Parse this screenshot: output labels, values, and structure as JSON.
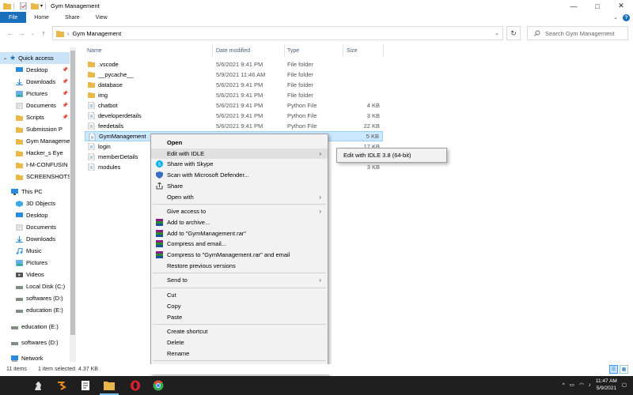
{
  "window": {
    "title": "Gym Management",
    "controls": {
      "minimize": "—",
      "maximize": "□",
      "close": "✕"
    }
  },
  "ribbon": {
    "tabs": [
      "File",
      "Home",
      "Share",
      "View"
    ],
    "help": "?"
  },
  "address": {
    "path_separator": "›",
    "path": "Gym Management",
    "search_placeholder": "Search Gym Management"
  },
  "nav": {
    "quick_access": "Quick access",
    "quick_items": [
      "Desktop",
      "Downloads",
      "Pictures",
      "Documents",
      "Scripts",
      "Submission P",
      "Gym Manageme",
      "Hacker_s Eye",
      "I-M-CONFUSIN",
      "SCREENSHOTS"
    ],
    "this_pc": "This PC",
    "pc_items": [
      "3D Objects",
      "Desktop",
      "Documents",
      "Downloads",
      "Music",
      "Pictures",
      "Videos",
      "Local Disk (C:)",
      "softwares (D:)",
      "education (E:)"
    ],
    "drives": [
      "education (E:)",
      "softwares (D:)"
    ],
    "network": "Network"
  },
  "columns": {
    "name": "Name",
    "date": "Date modified",
    "type": "Type",
    "size": "Size"
  },
  "files": [
    {
      "name": ".vscode",
      "date": "5/6/2021 9:41 PM",
      "type": "File folder",
      "size": "",
      "kind": "folder"
    },
    {
      "name": "__pycache__",
      "date": "5/9/2021 11:46 AM",
      "type": "File folder",
      "size": "",
      "kind": "folder"
    },
    {
      "name": "database",
      "date": "5/6/2021 9:41 PM",
      "type": "File folder",
      "size": "",
      "kind": "folder"
    },
    {
      "name": "img",
      "date": "5/6/2021 9:41 PM",
      "type": "File folder",
      "size": "",
      "kind": "folder"
    },
    {
      "name": "chatbot",
      "date": "5/6/2021 9:41 PM",
      "type": "Python File",
      "size": "4 KB",
      "kind": "py"
    },
    {
      "name": "developerdetails",
      "date": "5/6/2021 9:41 PM",
      "type": "Python File",
      "size": "3 KB",
      "kind": "py"
    },
    {
      "name": "feedetails",
      "date": "5/6/2021 9:41 PM",
      "type": "Python File",
      "size": "22 KB",
      "kind": "py"
    },
    {
      "name": "GymManagement",
      "date": "",
      "type": "",
      "size": "5 KB",
      "kind": "py"
    },
    {
      "name": "login",
      "date": "",
      "type": "",
      "size": "17 KB",
      "kind": "py"
    },
    {
      "name": "memberDetails",
      "date": "",
      "type": "",
      "size": "",
      "kind": "py"
    },
    {
      "name": "modules",
      "date": "",
      "type": "",
      "size": "3 KB",
      "kind": "py"
    }
  ],
  "context_menu": {
    "items": [
      {
        "label": "Open",
        "bold": true
      },
      {
        "label": "Edit with IDLE",
        "submenu": true,
        "hover": true
      },
      {
        "label": "Share with Skype",
        "icon": "skype"
      },
      {
        "label": "Scan with Microsoft Defender...",
        "icon": "defender"
      },
      {
        "label": "Share",
        "icon": "share"
      },
      {
        "label": "Open with",
        "submenu": true
      },
      {
        "sep": true
      },
      {
        "label": "Give access to",
        "submenu": true
      },
      {
        "label": "Add to archive...",
        "icon": "rar"
      },
      {
        "label": "Add to \"GymManagement.rar\"",
        "icon": "rar"
      },
      {
        "label": "Compress and email...",
        "icon": "rar"
      },
      {
        "label": "Compress to \"GymManagement.rar\" and email",
        "icon": "rar"
      },
      {
        "label": "Restore previous versions"
      },
      {
        "sep": true
      },
      {
        "label": "Send to",
        "submenu": true
      },
      {
        "sep": true
      },
      {
        "label": "Cut"
      },
      {
        "label": "Copy"
      },
      {
        "label": "Paste"
      },
      {
        "sep": true
      },
      {
        "label": "Create shortcut"
      },
      {
        "label": "Delete"
      },
      {
        "label": "Rename"
      },
      {
        "sep": true
      },
      {
        "label": "Properties"
      }
    ],
    "submenu_item": "Edit with IDLE 3.8 (64-bit)"
  },
  "status": {
    "items": "11 items",
    "selected": "1 item selected",
    "size": "4.37 KB"
  },
  "taskbar": {
    "time": "11:47 AM",
    "date": "5/9/2021"
  },
  "colors": {
    "accent": "#1a6fbd",
    "selection": "#cce8ff",
    "folder": "#e8b848"
  }
}
